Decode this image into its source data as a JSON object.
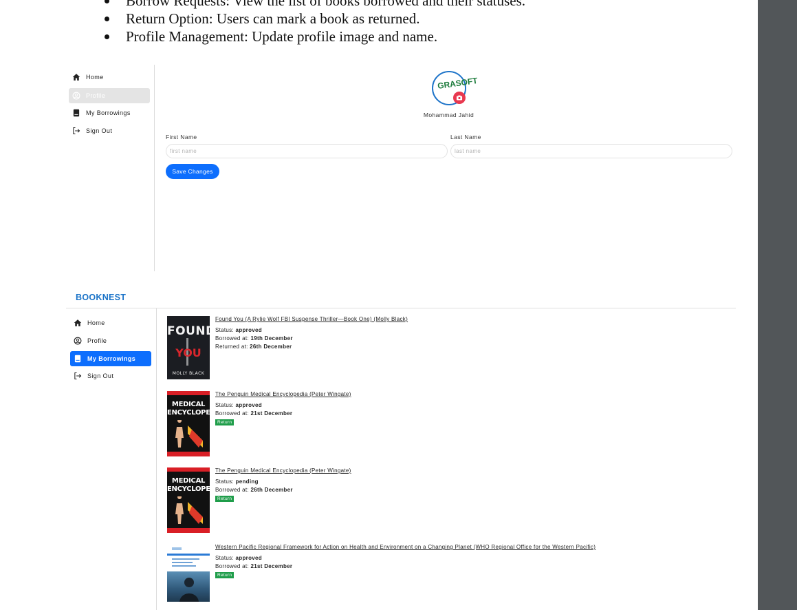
{
  "doc": {
    "bullets": [
      "Borrow Requests: View the list of books borrowed and their statuses.",
      "Return Option: Users can mark a book as returned.",
      "Profile Management: Update profile image and name."
    ]
  },
  "profile_screen": {
    "sidebar": [
      {
        "label": "Home",
        "icon": "home-icon",
        "active": false
      },
      {
        "label": "Profile",
        "icon": "user-circle-icon",
        "active": true
      },
      {
        "label": "My Borrowings",
        "icon": "book-icon",
        "active": false
      },
      {
        "label": "Sign Out",
        "icon": "sign-out-icon",
        "active": false
      }
    ],
    "avatar_text": "GRASOFT",
    "user_name": "Mohammad Jahid",
    "first_name_label": "First Name",
    "last_name_label": "Last Name",
    "first_name_placeholder": "first name",
    "last_name_placeholder": "last name",
    "save_label": "Save Changes"
  },
  "borrowings_screen": {
    "brand": "BOOKNEST",
    "sidebar": [
      {
        "label": "Home",
        "icon": "home-icon",
        "active": false
      },
      {
        "label": "Profile",
        "icon": "user-circle-icon",
        "active": false
      },
      {
        "label": "My Borrowings",
        "icon": "book-icon",
        "active": true
      },
      {
        "label": "Sign Out",
        "icon": "sign-out-icon",
        "active": false
      }
    ],
    "status_label": "Status:",
    "borrowed_label": "Borrowed at:",
    "returned_label": "Returned at:",
    "return_button": "Return",
    "books": [
      {
        "title": "Found You (A Rylie Wolf FBI Suspense Thriller—Book One) (Molly Black)",
        "status": "approved",
        "borrowed_at": "19th December",
        "returned_at": "26th December",
        "cover": {
          "line1": "FOUND",
          "line2": "YOU",
          "author": "MOLLY BLACK"
        }
      },
      {
        "title": "The Penguin Medical Encyclopedia (Peter Wingate)",
        "status": "approved",
        "borrowed_at": "21st December",
        "cover": {
          "line1": "MEDICAL",
          "line2": "ENCYCLOPEDIA"
        }
      },
      {
        "title": "The Penguin Medical Encyclopedia (Peter Wingate)",
        "status": "pending",
        "borrowed_at": "26th December",
        "cover": {
          "line1": "MEDICAL",
          "line2": "ENCYCLOPEDIA"
        }
      },
      {
        "title": "Western Pacific Regional Framework for Action on Health and Environment on a Changing Planet (WHO Regional Office for the Western Pacific)",
        "status": "approved",
        "borrowed_at": "21st December"
      }
    ]
  },
  "colors": {
    "primary": "#0d6efd",
    "brand": "#1a73c8",
    "return_green": "#1f9d4a",
    "active_gray": "#e4e4e4"
  }
}
